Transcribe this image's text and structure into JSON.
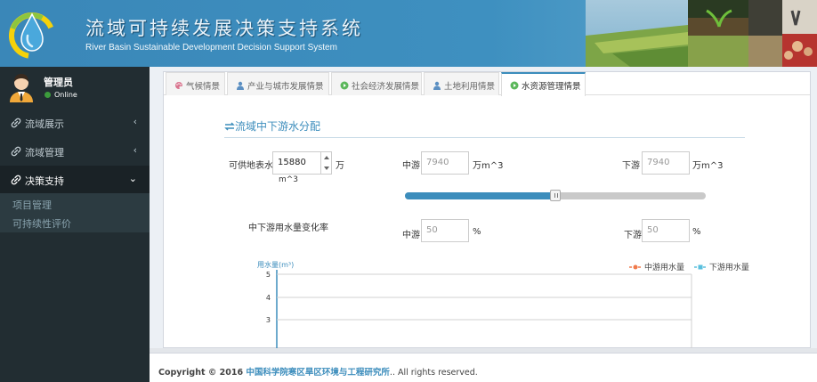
{
  "header": {
    "title_zh": "流域可持续发展决策支持系统",
    "title_en": "River Basin Sustainable Development Decision Support System"
  },
  "user": {
    "name": "管理员",
    "status": "Online"
  },
  "sidebar": {
    "items": [
      {
        "label": "流域展示",
        "icon": "link-icon",
        "arrow": "‹"
      },
      {
        "label": "流域管理",
        "icon": "link-icon",
        "arrow": "‹"
      },
      {
        "label": "决策支持",
        "icon": "link-icon",
        "arrow": "⌄",
        "active": true
      }
    ],
    "submenu": [
      "项目管理",
      "可持续性评价"
    ]
  },
  "tabs": [
    {
      "label": "气候情景",
      "icon": "palette-icon"
    },
    {
      "label": "产业与城市发展情景",
      "icon": "user-icon"
    },
    {
      "label": "社会经济发展情景",
      "icon": "play-circle-icon"
    },
    {
      "label": "土地利用情景",
      "icon": "user-icon"
    },
    {
      "label": "水资源管理情景",
      "icon": "play-circle-icon",
      "active": true
    }
  ],
  "section": {
    "title": "流域中下游水分配",
    "icon": "exchange-icon"
  },
  "supply": {
    "label": "可供地表水",
    "value": "15880",
    "unit_line1": "万",
    "unit_line2": "m^3"
  },
  "midstream": {
    "label": "中游",
    "value": "7940",
    "unit": "万m^3"
  },
  "downstream": {
    "label": "下游",
    "value": "7940",
    "unit": "万m^3"
  },
  "slider": {
    "value_fraction": 0.5
  },
  "change_rate": {
    "label": "中下游用水量变化率",
    "mid_label": "中游",
    "mid_value": "50",
    "down_label": "下游",
    "down_value": "50",
    "unit": "%"
  },
  "chart_data": {
    "type": "line",
    "ylabel": "用水量(m³)",
    "y_ticks": [
      "5",
      "4",
      "3"
    ],
    "series": [
      {
        "name": "中游用水量",
        "color": "#f07a4b",
        "values": []
      },
      {
        "name": "下游用水量",
        "color": "#5bc0de",
        "values": []
      }
    ]
  },
  "footer": {
    "prefix": "Copyright © 2016 ",
    "org": "中国科学院寒区旱区环境与工程研究所",
    "suffix": ".. All rights reserved."
  },
  "colors": {
    "header": "#3c8dbc",
    "sidebar": "#222d32",
    "accent": "#3c8dbc"
  }
}
